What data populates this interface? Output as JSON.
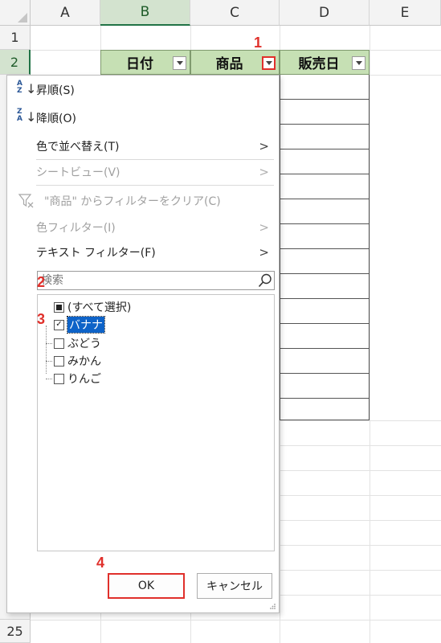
{
  "sheet": {
    "columns": [
      "A",
      "B",
      "C",
      "D",
      "E"
    ],
    "selected_column": "B",
    "rows": [
      "1",
      "2",
      "25"
    ],
    "selected_row": "2",
    "table_headers": [
      {
        "label": "日付"
      },
      {
        "label": "商品"
      },
      {
        "label": "販売日"
      }
    ]
  },
  "markers": [
    "1",
    "2",
    "3",
    "4"
  ],
  "filter_menu": {
    "sort_asc": "昇順(S)",
    "sort_desc": "降順(O)",
    "sort_by_color": "色で並べ替え(T)",
    "sheet_view": "シートビュー(V)",
    "clear_filter": "\"商品\" からフィルターをクリア(C)",
    "color_filter": "色フィルター(I)",
    "text_filter": "テキスト フィルター(F)",
    "search_placeholder": "検索",
    "items": [
      {
        "label": "(すべて選択)",
        "state": "partial"
      },
      {
        "label": "バナナ",
        "state": "checked"
      },
      {
        "label": "ぶどう",
        "state": "unchecked"
      },
      {
        "label": "みかん",
        "state": "unchecked"
      },
      {
        "label": "りんご",
        "state": "unchecked"
      }
    ],
    "ok_label": "OK",
    "cancel_label": "キャンセル"
  },
  "colors": {
    "header_fill": "#c6e0b4",
    "highlight_red": "#e0302b",
    "selection_blue": "#0e63c8"
  }
}
